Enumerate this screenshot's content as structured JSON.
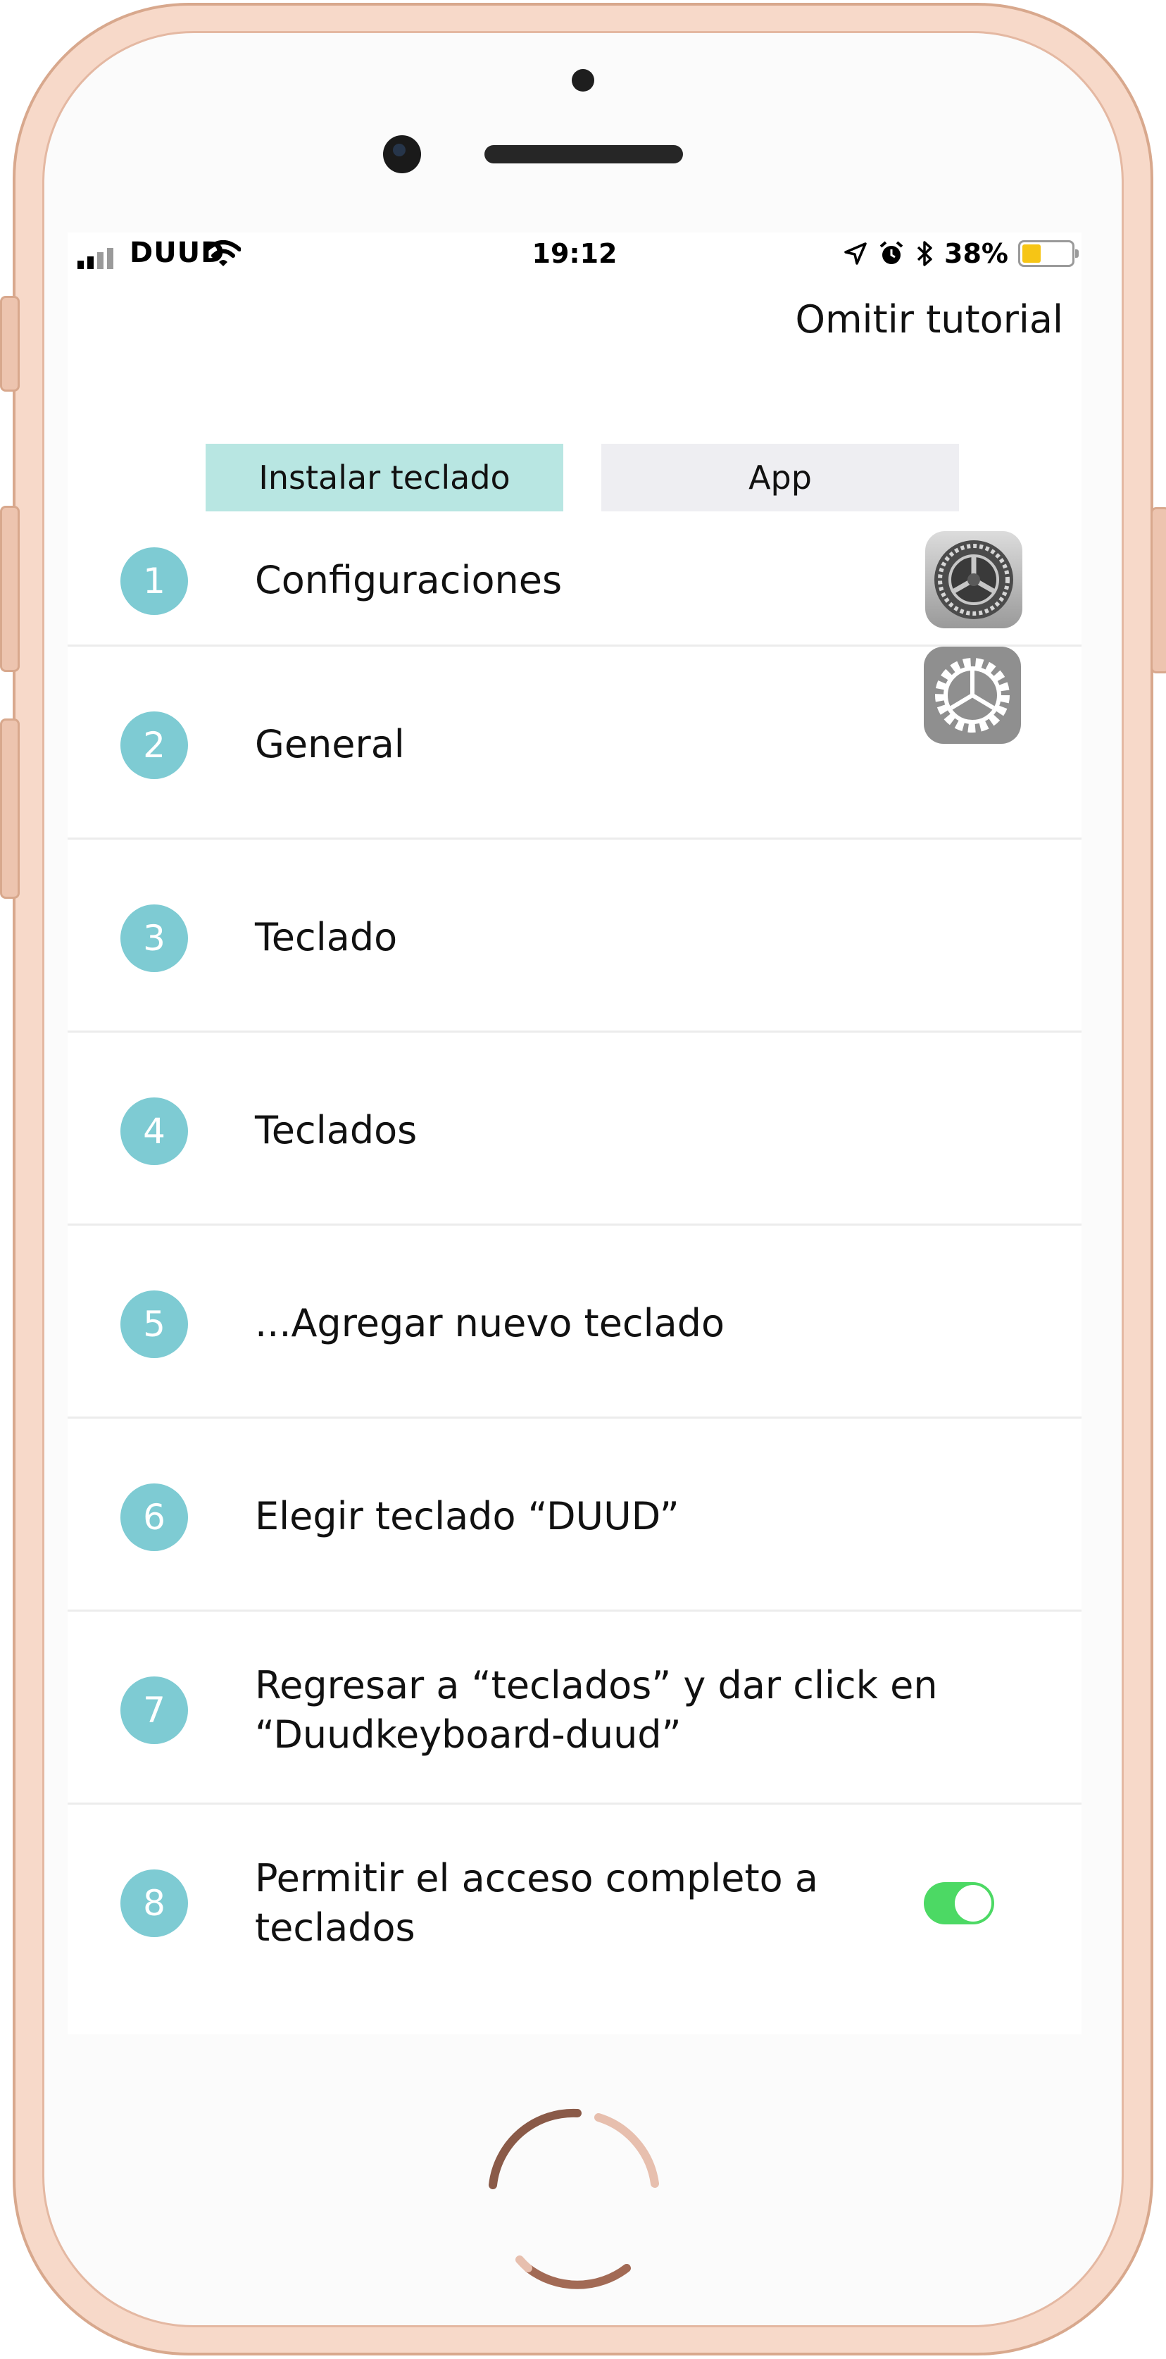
{
  "status_bar": {
    "carrier": "DUUD",
    "time": "19:12",
    "battery_percent": "38%",
    "battery_level": 0.38,
    "battery_color": "#f6c515",
    "icons": [
      "signal-icon",
      "wifi-icon",
      "location-arrow-icon",
      "alarm-icon",
      "bluetooth-icon",
      "battery-icon"
    ]
  },
  "header": {
    "skip_label": "Omitir tutorial"
  },
  "tabs": [
    {
      "label": "Instalar teclado",
      "active": true
    },
    {
      "label": "App",
      "active": false
    }
  ],
  "steps": [
    {
      "number": "1",
      "text": "Configuraciones",
      "icon": "settings-gear-icon"
    },
    {
      "number": "2",
      "text": "General",
      "icon": "general-gear-icon"
    },
    {
      "number": "3",
      "text": "Teclado"
    },
    {
      "number": "4",
      "text": "Teclados"
    },
    {
      "number": "5",
      "text": "...Agregar nuevo teclado"
    },
    {
      "number": "6",
      "text": "Elegir teclado “DUUD”"
    },
    {
      "number": "7",
      "text": "Regresar a “teclados” y dar click en “Duudkeyboard-duud”"
    },
    {
      "number": "8",
      "text": "Permitir el acceso completo a teclados",
      "toggle": "on"
    }
  ],
  "colors": {
    "accent_teal": "#7ecbd3",
    "active_tab": "#b8e6e2",
    "inactive_tab": "#eeeef2",
    "toggle_on": "#4cd964",
    "frame": "#f7d9c9"
  }
}
